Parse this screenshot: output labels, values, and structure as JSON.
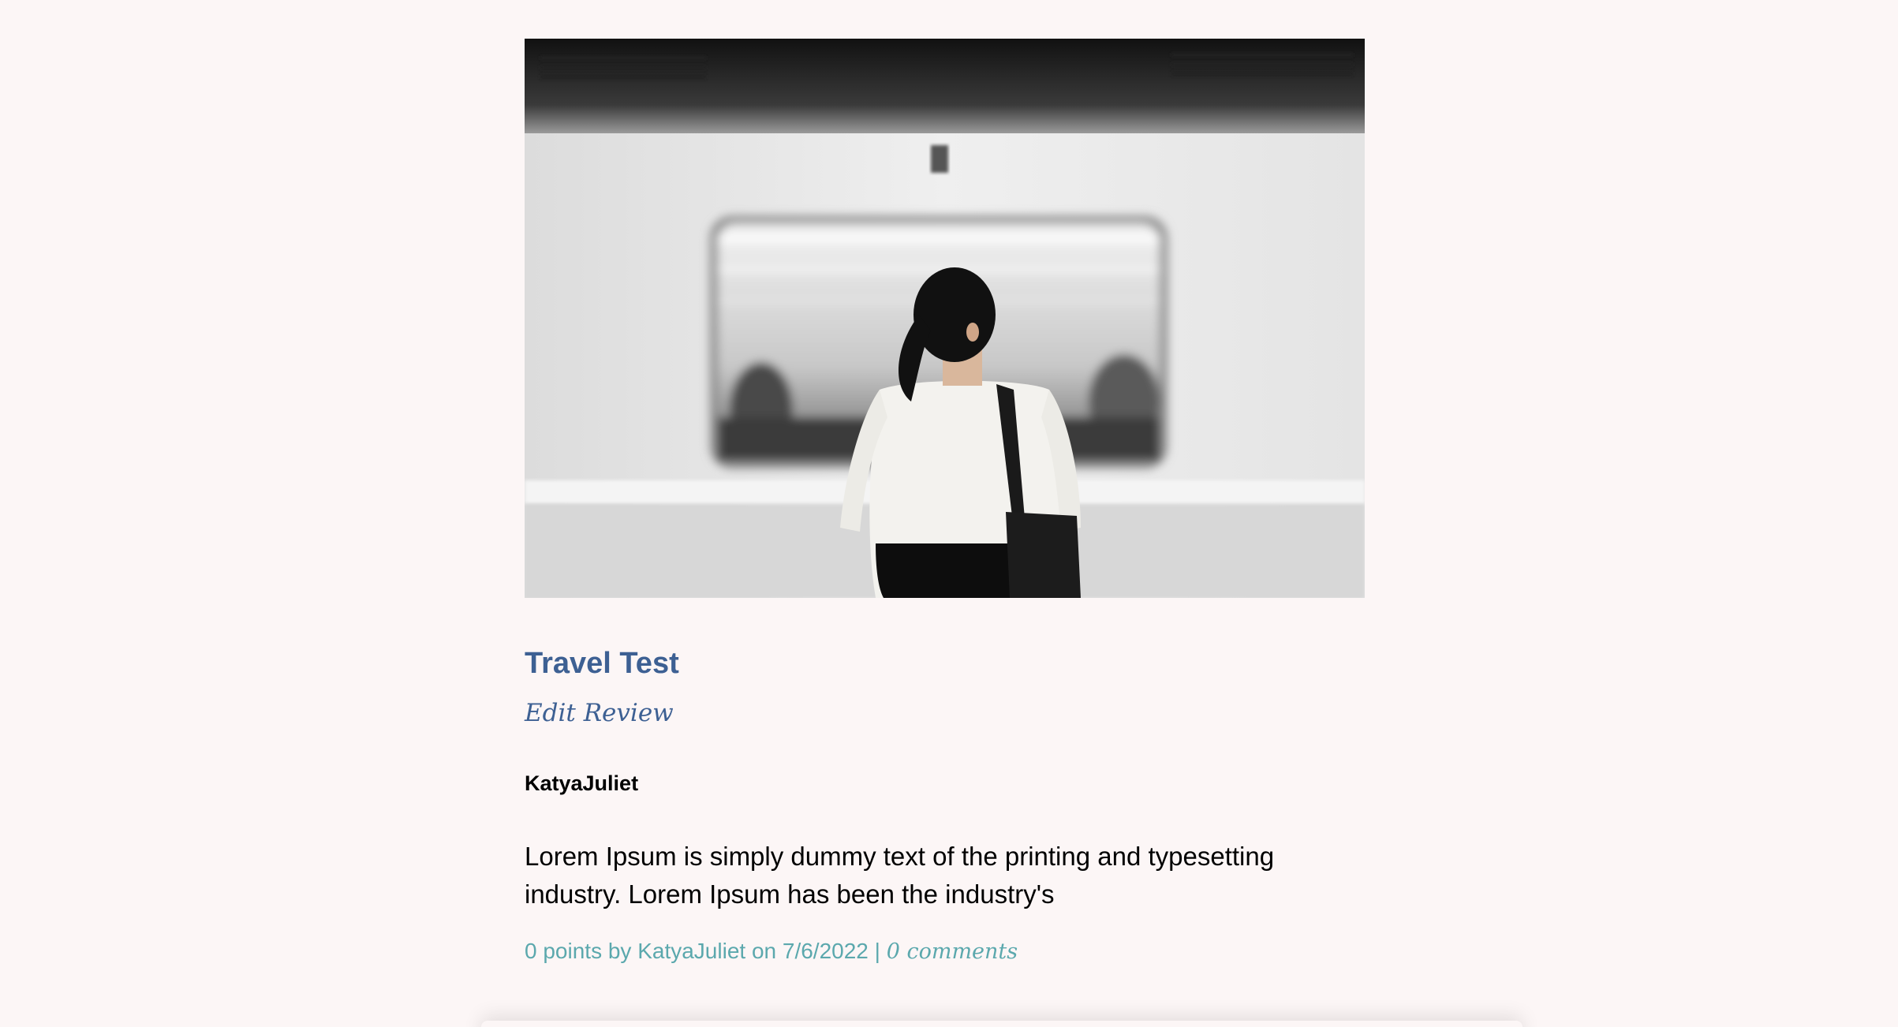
{
  "post": {
    "image": {
      "icon": "woman-at-subway-photo"
    },
    "title": "Travel Test",
    "edit_label": "Edit Review",
    "author": "KatyaJuliet",
    "body": "Lorem Ipsum is simply dummy text of the printing and typesetting industry. Lorem Ipsum has been the industry's",
    "meta": {
      "points_text": "0 points by KatyaJuliet on 7/6/2022",
      "separator": "|",
      "comments_label": "0 comments"
    }
  },
  "colors": {
    "background": "#fcf6f6",
    "title": "#3d6093",
    "meta": "#5ba8ad"
  }
}
